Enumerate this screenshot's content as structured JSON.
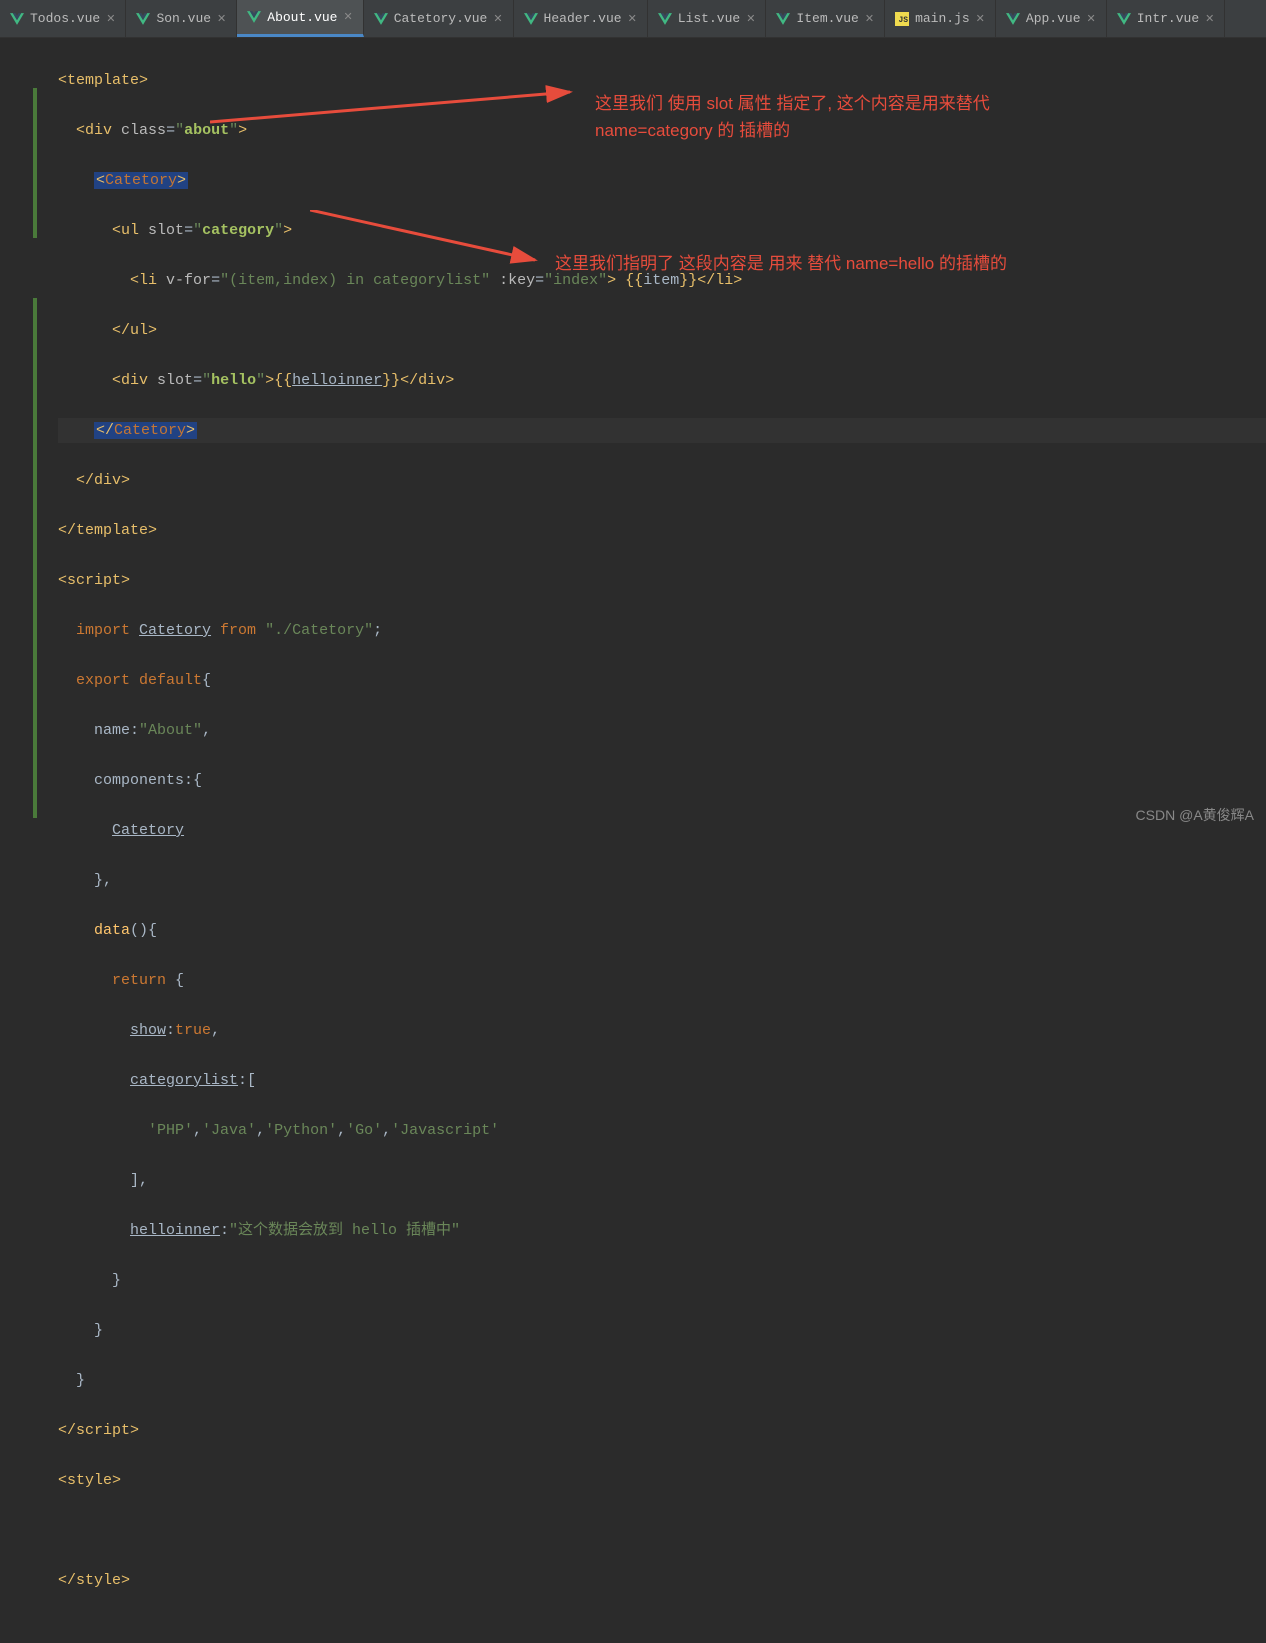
{
  "tabs": [
    {
      "label": "Todos.vue",
      "type": "vue"
    },
    {
      "label": "Son.vue",
      "type": "vue"
    },
    {
      "label": "About.vue",
      "type": "vue",
      "active": true
    },
    {
      "label": "Catetory.vue",
      "type": "vue"
    },
    {
      "label": "Header.vue",
      "type": "vue"
    },
    {
      "label": "List.vue",
      "type": "vue"
    },
    {
      "label": "Item.vue",
      "type": "vue"
    },
    {
      "label": "main.js",
      "type": "js"
    },
    {
      "label": "App.vue",
      "type": "vue"
    },
    {
      "label": "Intr.vue",
      "type": "vue"
    }
  ],
  "annotations": {
    "top": "这里我们 使用 slot 属性 指定了, 这个内容是用来替代  name=category 的  插槽的",
    "bottom": "这里我们指明了 这段内容是 用来 替代 name=hello  的插槽的"
  },
  "code": {
    "l1": {
      "t1": "<",
      "t2": "template",
      "t3": ">"
    },
    "l2": {
      "t1": "<",
      "t2": "div ",
      "a1": "class",
      "eq": "=",
      "v1": "\"",
      "v2": "about",
      "v3": "\"",
      "t3": ">"
    },
    "l3": {
      "t1": "<",
      "t2": "Catetory",
      "t3": ">"
    },
    "l4": {
      "t1": "<",
      "t2": "ul ",
      "a1": "slot",
      "eq": "=",
      "v1": "\"",
      "v2": "category",
      "v3": "\"",
      "t3": ">"
    },
    "l5": {
      "t1": "<",
      "t2": "li ",
      "a1": "v-for",
      "eq": "=",
      "v1": "\"(item,index) in categorylist\"",
      "a2": " :key",
      "eq2": "=",
      "v2": "\"index\"",
      "t3": "> {{",
      "var": "item",
      "t4": "}}</",
      "t5": "li",
      "t6": ">"
    },
    "l6": {
      "t1": "</",
      "t2": "ul",
      "t3": ">"
    },
    "l7": {
      "t1": "<",
      "t2": "div ",
      "a1": "slot",
      "eq": "=",
      "v1": "\"",
      "v2": "hello",
      "v3": "\"",
      "t3": ">{{",
      "var": "helloinner",
      "t4": "}}</",
      "t5": "div",
      "t6": ">"
    },
    "l8": {
      "t1": "</",
      "t2": "Catetory",
      "t3": ">"
    },
    "l9": {
      "t1": "</",
      "t2": "div",
      "t3": ">"
    },
    "l10": {
      "t1": "</",
      "t2": "template",
      "t3": ">"
    },
    "l11": {
      "t1": "<",
      "t2": "script",
      "t3": ">"
    },
    "l12": {
      "k1": "import ",
      "n1": "Catetory",
      "k2": " from ",
      "s1": "\"./Catetory\"",
      "p1": ";"
    },
    "l13": {
      "k1": "export default",
      "p1": "{"
    },
    "l14": {
      "n1": "name",
      "p1": ":",
      "s1": "\"About\"",
      "p2": ","
    },
    "l15": {
      "n1": "components",
      "p1": ":{"
    },
    "l16": {
      "n1": "Catetory"
    },
    "l17": {
      "p1": "},"
    },
    "l18": {
      "n1": "data",
      "p1": "(){"
    },
    "l19": {
      "k1": "return ",
      "p1": "{"
    },
    "l20": {
      "n1": "show",
      "p1": ":",
      "k1": "true",
      "p2": ","
    },
    "l21": {
      "n1": "categorylist",
      "p1": ":["
    },
    "l22": {
      "s1": "'PHP'",
      "p1": ",",
      "s2": "'Java'",
      "p2": ",",
      "s3": "'Python'",
      "p3": ",",
      "s4": "'Go'",
      "p4": ",",
      "s5": "'Javascript'"
    },
    "l23": {
      "p1": "],"
    },
    "l24": {
      "n1": "helloinner",
      "p1": ":",
      "s1": "\"这个数据会放到 hello 插槽中\""
    },
    "l25": {
      "p1": "}"
    },
    "l26": {
      "p1": "}"
    },
    "l27": {
      "p1": "}"
    },
    "l28": {
      "t1": "</",
      "t2": "script",
      "t3": ">"
    },
    "l29": {
      "t1": "<",
      "t2": "style",
      "t3": ">"
    },
    "l30": "",
    "l31": {
      "t1": "</",
      "t2": "style",
      "t3": ">"
    }
  },
  "watermark": "CSDN @A黄俊辉A"
}
